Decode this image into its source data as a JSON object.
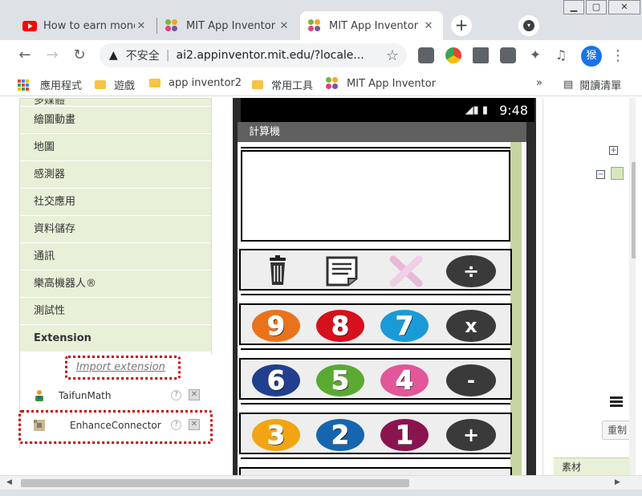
{
  "browser": {
    "tabs": [
      {
        "title": "How to earn mone",
        "icon": "youtube-icon",
        "active": false
      },
      {
        "title": "MIT App Inventor",
        "icon": "mit-app-inventor-icon",
        "active": false
      },
      {
        "title": "MIT App Inventor",
        "icon": "mit-app-inventor-icon",
        "active": true
      }
    ],
    "new_tab": "+",
    "close_glyph": "✕",
    "window_buttons": {
      "minimize": "▁",
      "maximize": "▢",
      "close": "✕"
    },
    "omnibox": {
      "insecure_label": "不安全",
      "url": "ai2.appinventor.mit.edu/?locale..."
    },
    "avatar_text": "猴",
    "bookmarks": {
      "apps": "應用程式",
      "items": [
        "遊戲",
        "app inventor2",
        "常用工具",
        "MIT App Inventor"
      ],
      "overflow": "»",
      "reading_list": "閱讀清單"
    }
  },
  "palette": {
    "partial_top": "多媒體",
    "categories": [
      "繪圖動畫",
      "地圖",
      "感測器",
      "社交應用",
      "資料儲存",
      "通訊",
      "樂高機器人®",
      "測試性",
      "Extension"
    ],
    "import_extension": "Import extension",
    "extensions": [
      {
        "name": "TaifunMath",
        "icon": "taifun-math-icon"
      },
      {
        "name": "EnhanceConnector",
        "icon": "extension-puzzle-icon"
      }
    ],
    "help_glyph": "?",
    "delete_glyph": "✕"
  },
  "viewer": {
    "status_time": "9:48",
    "screen_title": "計算機",
    "rows": [
      {
        "buttons": [
          {
            "type": "icon",
            "name": "trash-icon"
          },
          {
            "type": "icon",
            "name": "notepad-icon"
          },
          {
            "type": "icon",
            "name": "cancel-x-icon"
          },
          {
            "type": "op",
            "label": "÷"
          }
        ]
      },
      {
        "buttons": [
          {
            "type": "digit",
            "label": "9",
            "color": "#e8731c"
          },
          {
            "type": "digit",
            "label": "8",
            "color": "#d6101c"
          },
          {
            "type": "digit",
            "label": "7",
            "color": "#1a9bd7"
          },
          {
            "type": "op",
            "label": "x"
          }
        ]
      },
      {
        "buttons": [
          {
            "type": "digit",
            "label": "6",
            "color": "#223f8f"
          },
          {
            "type": "digit",
            "label": "5",
            "color": "#5aaa32"
          },
          {
            "type": "digit",
            "label": "4",
            "color": "#e2569a"
          },
          {
            "type": "op",
            "label": "-"
          }
        ]
      },
      {
        "buttons": [
          {
            "type": "digit",
            "label": "3",
            "color": "#f2a413"
          },
          {
            "type": "digit",
            "label": "2",
            "color": "#1565b0"
          },
          {
            "type": "digit",
            "label": "1",
            "color": "#8b1450"
          },
          {
            "type": "op",
            "label": "+"
          }
        ]
      }
    ]
  },
  "right_panel": {
    "reset_label": "重制",
    "assets_label": "素材",
    "expand_glyph": "+",
    "collapse_glyph": "−"
  }
}
